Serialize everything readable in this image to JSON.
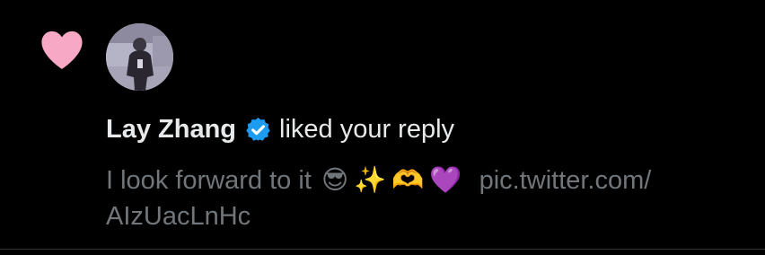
{
  "notification": {
    "actor_name": "Lay Zhang",
    "action": "liked your reply",
    "verified": true,
    "tweet_text": "I look forward to it",
    "emojis": [
      "😎",
      "✨",
      "🫶",
      "💜"
    ],
    "link_part1": "pic.twitter.com/",
    "link_part2": "AIzUacLnHc",
    "icons": {
      "type_icon": "heart-icon",
      "verified_icon": "verified-badge-icon"
    }
  },
  "colors": {
    "background": "#000000",
    "heart": "#f91880",
    "verified": "#1d9bf0",
    "primary_text": "#e7e9ea",
    "secondary_text": "#71767b"
  }
}
